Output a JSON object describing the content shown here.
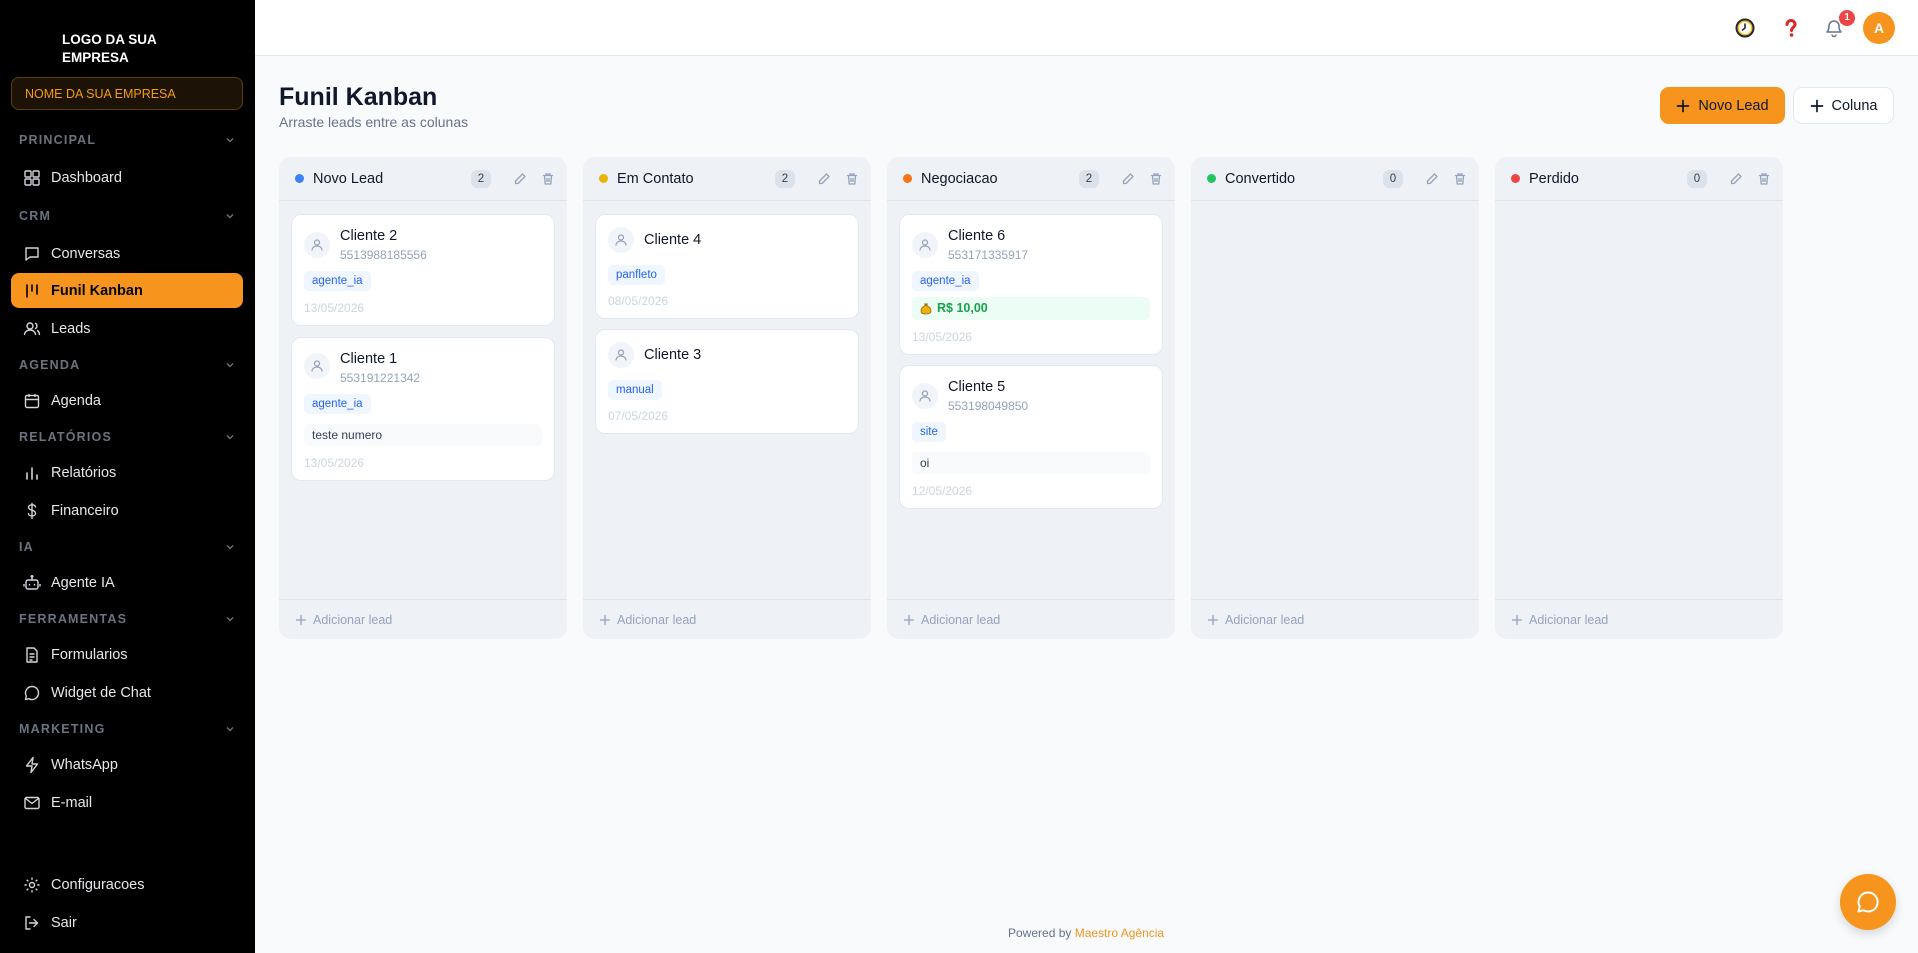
{
  "sidebar": {
    "logo": "LOGO DA SUA EMPRESA",
    "company": "NOME DA SUA EMPRESA",
    "sections": {
      "principal": "PRINCIPAL",
      "crm": "CRM",
      "agenda": "AGENDA",
      "relatorios": "RELATÓRIOS",
      "ia": "IA",
      "ferramentas": "FERRAMENTAS",
      "marketing": "MARKETING"
    },
    "items": {
      "dashboard": "Dashboard",
      "conversas": "Conversas",
      "funil": "Funil Kanban",
      "leads": "Leads",
      "agenda": "Agenda",
      "relatorios": "Relatórios",
      "financeiro": "Financeiro",
      "agente": "Agente IA",
      "formularios": "Formularios",
      "widget": "Widget de Chat",
      "whatsapp": "WhatsApp",
      "email": "E-mail",
      "config": "Configuracoes",
      "sair": "Sair"
    }
  },
  "topbar": {
    "notification_count": "1",
    "avatar_initial": "A"
  },
  "page": {
    "title": "Funil Kanban",
    "subtitle": "Arraste leads entre as colunas",
    "new_lead_label": "Novo Lead",
    "column_label": "Coluna"
  },
  "colors": {
    "accent": "#f7941d",
    "novo": "#3b82f6",
    "contato": "#eab308",
    "negociacao": "#f97316",
    "convertido": "#22c55e",
    "perdido": "#ef4444"
  },
  "columns": [
    {
      "title": "Novo Lead",
      "count": "2",
      "add_label": "Adicionar lead",
      "cards": [
        {
          "name": "Cliente 2",
          "phone": "5513988185556",
          "tag": "agente_ia",
          "date": "13/05/2026"
        },
        {
          "name": "Cliente 1",
          "phone": "553191221342",
          "tag": "agente_ia",
          "note": "teste numero",
          "date": "13/05/2026"
        }
      ]
    },
    {
      "title": "Em Contato",
      "count": "2",
      "add_label": "Adicionar lead",
      "cards": [
        {
          "name": "Cliente 4",
          "tag": "panfleto",
          "date": "08/05/2026"
        },
        {
          "name": "Cliente 3",
          "tag": "manual",
          "date": "07/05/2026"
        }
      ]
    },
    {
      "title": "Negociacao",
      "count": "2",
      "add_label": "Adicionar lead",
      "cards": [
        {
          "name": "Cliente 6",
          "phone": "553171335917",
          "tag": "agente_ia",
          "value": "R$ 10,00",
          "date": "13/05/2026"
        },
        {
          "name": "Cliente 5",
          "phone": "553198049850",
          "tag": "site",
          "note": "oi",
          "date": "12/05/2026"
        }
      ]
    },
    {
      "title": "Convertido",
      "count": "0",
      "add_label": "Adicionar lead",
      "cards": []
    },
    {
      "title": "Perdido",
      "count": "0",
      "add_label": "Adicionar lead",
      "cards": []
    }
  ],
  "footer": {
    "prefix": "Powered by",
    "brand": "Maestro Agência"
  }
}
